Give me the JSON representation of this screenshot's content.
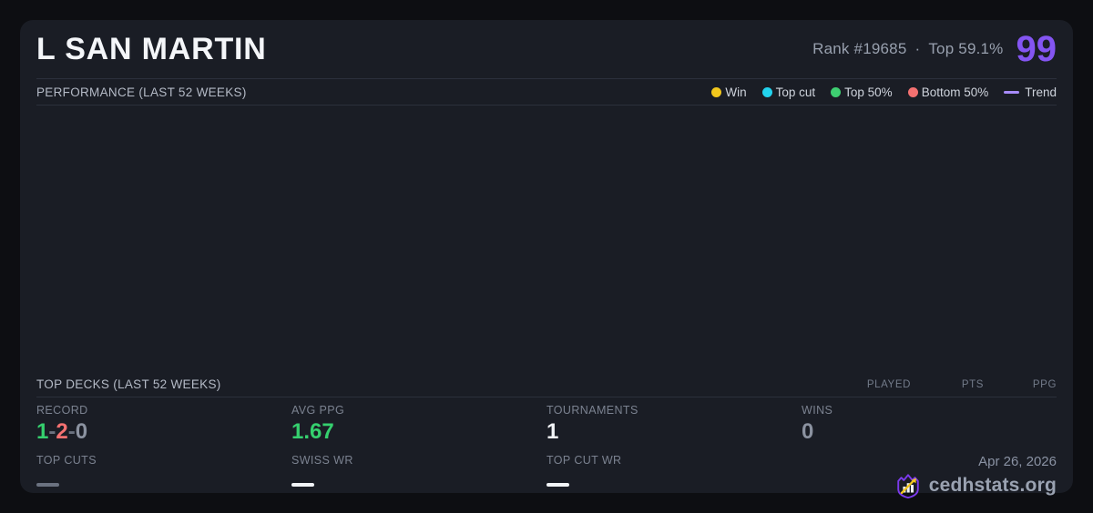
{
  "header": {
    "title": "L SAN MARTIN",
    "rank": "Rank #19685",
    "dot_separator": "·",
    "top_percent": "Top 59.1%",
    "score": "99"
  },
  "performance": {
    "title": "PERFORMANCE (LAST 52 WEEKS)",
    "legend": [
      {
        "label": "Win",
        "color": "#f2c71d"
      },
      {
        "label": "Top cut",
        "color": "#22d3ee"
      },
      {
        "label": "Top 50%",
        "color": "#3ecf71"
      },
      {
        "label": "Bottom 50%",
        "color": "#f47171"
      },
      {
        "label": "Trend",
        "color": "#a78bfa",
        "type": "line"
      }
    ],
    "chart": {
      "type": "scatter",
      "points": []
    }
  },
  "top_decks": {
    "title": "TOP DECKS (LAST 52 WEEKS)",
    "columns": [
      "PLAYED",
      "PTS",
      "PPG"
    ],
    "rows": []
  },
  "stats": {
    "record": {
      "label": "RECORD",
      "wins": "1",
      "losses": "2",
      "draws": "0",
      "separator": "-"
    },
    "avg_ppg": {
      "label": "AVG PPG",
      "value": "1.67"
    },
    "tournaments": {
      "label": "TOURNAMENTS",
      "value": "1"
    },
    "wins": {
      "label": "WINS",
      "value": "0"
    },
    "top_cuts": {
      "label": "TOP CUTS",
      "value": "—"
    },
    "swiss_wr": {
      "label": "SWISS WR",
      "value": "—"
    },
    "top_cut_wr": {
      "label": "TOP CUT WR",
      "value": "—"
    }
  },
  "footer": {
    "date": "Apr 26, 2026",
    "brand": "cedhstats.org"
  },
  "colors": {
    "card_background": "#1a1d25",
    "page_background": "#0d0e12",
    "accent_purple": "#8455f2",
    "green": "#35d06e",
    "red": "#f47171",
    "logo_purple": "#7c3aed",
    "logo_gold": "#f2c71d"
  }
}
